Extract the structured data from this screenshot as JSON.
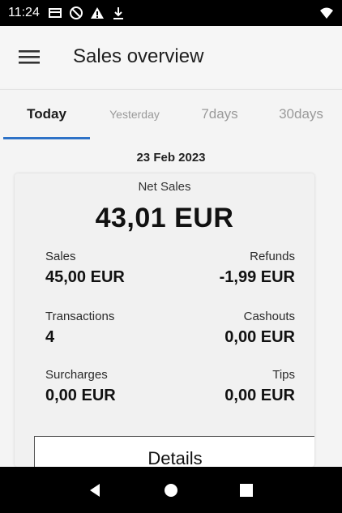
{
  "status_bar": {
    "time": "11:24",
    "icons_left": [
      "sim-card-icon",
      "do-not-disturb-icon",
      "warning-icon",
      "download-icon"
    ],
    "icons_right": [
      "wifi-icon"
    ]
  },
  "app_bar": {
    "title": "Sales overview",
    "menu_icon": "hamburger-menu-icon"
  },
  "tabs": [
    {
      "label": "Today",
      "active": true
    },
    {
      "label": "Yesterday",
      "active": false
    },
    {
      "label": "7days",
      "active": false
    },
    {
      "label": "30days",
      "active": false
    }
  ],
  "date": "23 Feb 2023",
  "summary": {
    "net_sales_label": "Net Sales",
    "net_sales_value": "43,01 EUR",
    "sales_label": "Sales",
    "sales_value": "45,00 EUR",
    "refunds_label": "Refunds",
    "refunds_value": "-1,99 EUR",
    "transactions_label": "Transactions",
    "transactions_value": "4",
    "cashouts_label": "Cashouts",
    "cashouts_value": "0,00 EUR",
    "surcharges_label": "Surcharges",
    "surcharges_value": "0,00 EUR",
    "tips_label": "Tips",
    "tips_value": "0,00 EUR",
    "details_label": "Details"
  },
  "nav_bar": {
    "back_icon": "back-triangle-icon",
    "home_icon": "home-circle-icon",
    "recents_icon": "recents-square-icon"
  },
  "colors": {
    "accent": "#2e72c7",
    "background": "#f4f4f4",
    "system_bar": "#000000"
  }
}
